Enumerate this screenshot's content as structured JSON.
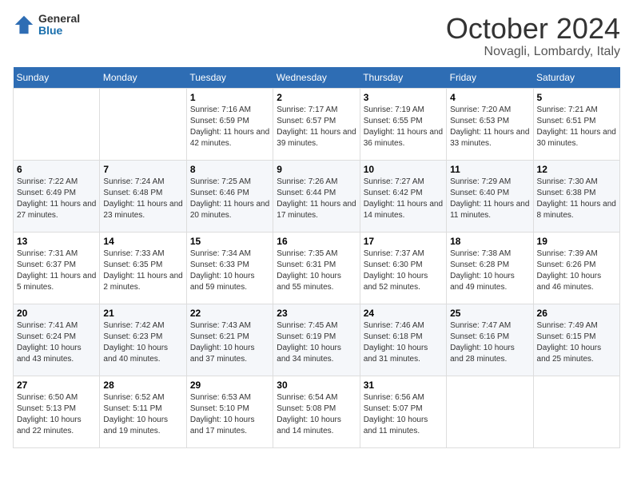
{
  "header": {
    "logo_general": "General",
    "logo_blue": "Blue",
    "month_title": "October 2024",
    "location": "Novagli, Lombardy, Italy"
  },
  "days_of_week": [
    "Sunday",
    "Monday",
    "Tuesday",
    "Wednesday",
    "Thursday",
    "Friday",
    "Saturday"
  ],
  "weeks": [
    [
      {
        "day": "",
        "info": ""
      },
      {
        "day": "",
        "info": ""
      },
      {
        "day": "1",
        "info": "Sunrise: 7:16 AM\nSunset: 6:59 PM\nDaylight: 11 hours and 42 minutes."
      },
      {
        "day": "2",
        "info": "Sunrise: 7:17 AM\nSunset: 6:57 PM\nDaylight: 11 hours and 39 minutes."
      },
      {
        "day": "3",
        "info": "Sunrise: 7:19 AM\nSunset: 6:55 PM\nDaylight: 11 hours and 36 minutes."
      },
      {
        "day": "4",
        "info": "Sunrise: 7:20 AM\nSunset: 6:53 PM\nDaylight: 11 hours and 33 minutes."
      },
      {
        "day": "5",
        "info": "Sunrise: 7:21 AM\nSunset: 6:51 PM\nDaylight: 11 hours and 30 minutes."
      }
    ],
    [
      {
        "day": "6",
        "info": "Sunrise: 7:22 AM\nSunset: 6:49 PM\nDaylight: 11 hours and 27 minutes."
      },
      {
        "day": "7",
        "info": "Sunrise: 7:24 AM\nSunset: 6:48 PM\nDaylight: 11 hours and 23 minutes."
      },
      {
        "day": "8",
        "info": "Sunrise: 7:25 AM\nSunset: 6:46 PM\nDaylight: 11 hours and 20 minutes."
      },
      {
        "day": "9",
        "info": "Sunrise: 7:26 AM\nSunset: 6:44 PM\nDaylight: 11 hours and 17 minutes."
      },
      {
        "day": "10",
        "info": "Sunrise: 7:27 AM\nSunset: 6:42 PM\nDaylight: 11 hours and 14 minutes."
      },
      {
        "day": "11",
        "info": "Sunrise: 7:29 AM\nSunset: 6:40 PM\nDaylight: 11 hours and 11 minutes."
      },
      {
        "day": "12",
        "info": "Sunrise: 7:30 AM\nSunset: 6:38 PM\nDaylight: 11 hours and 8 minutes."
      }
    ],
    [
      {
        "day": "13",
        "info": "Sunrise: 7:31 AM\nSunset: 6:37 PM\nDaylight: 11 hours and 5 minutes."
      },
      {
        "day": "14",
        "info": "Sunrise: 7:33 AM\nSunset: 6:35 PM\nDaylight: 11 hours and 2 minutes."
      },
      {
        "day": "15",
        "info": "Sunrise: 7:34 AM\nSunset: 6:33 PM\nDaylight: 10 hours and 59 minutes."
      },
      {
        "day": "16",
        "info": "Sunrise: 7:35 AM\nSunset: 6:31 PM\nDaylight: 10 hours and 55 minutes."
      },
      {
        "day": "17",
        "info": "Sunrise: 7:37 AM\nSunset: 6:30 PM\nDaylight: 10 hours and 52 minutes."
      },
      {
        "day": "18",
        "info": "Sunrise: 7:38 AM\nSunset: 6:28 PM\nDaylight: 10 hours and 49 minutes."
      },
      {
        "day": "19",
        "info": "Sunrise: 7:39 AM\nSunset: 6:26 PM\nDaylight: 10 hours and 46 minutes."
      }
    ],
    [
      {
        "day": "20",
        "info": "Sunrise: 7:41 AM\nSunset: 6:24 PM\nDaylight: 10 hours and 43 minutes."
      },
      {
        "day": "21",
        "info": "Sunrise: 7:42 AM\nSunset: 6:23 PM\nDaylight: 10 hours and 40 minutes."
      },
      {
        "day": "22",
        "info": "Sunrise: 7:43 AM\nSunset: 6:21 PM\nDaylight: 10 hours and 37 minutes."
      },
      {
        "day": "23",
        "info": "Sunrise: 7:45 AM\nSunset: 6:19 PM\nDaylight: 10 hours and 34 minutes."
      },
      {
        "day": "24",
        "info": "Sunrise: 7:46 AM\nSunset: 6:18 PM\nDaylight: 10 hours and 31 minutes."
      },
      {
        "day": "25",
        "info": "Sunrise: 7:47 AM\nSunset: 6:16 PM\nDaylight: 10 hours and 28 minutes."
      },
      {
        "day": "26",
        "info": "Sunrise: 7:49 AM\nSunset: 6:15 PM\nDaylight: 10 hours and 25 minutes."
      }
    ],
    [
      {
        "day": "27",
        "info": "Sunrise: 6:50 AM\nSunset: 5:13 PM\nDaylight: 10 hours and 22 minutes."
      },
      {
        "day": "28",
        "info": "Sunrise: 6:52 AM\nSunset: 5:11 PM\nDaylight: 10 hours and 19 minutes."
      },
      {
        "day": "29",
        "info": "Sunrise: 6:53 AM\nSunset: 5:10 PM\nDaylight: 10 hours and 17 minutes."
      },
      {
        "day": "30",
        "info": "Sunrise: 6:54 AM\nSunset: 5:08 PM\nDaylight: 10 hours and 14 minutes."
      },
      {
        "day": "31",
        "info": "Sunrise: 6:56 AM\nSunset: 5:07 PM\nDaylight: 10 hours and 11 minutes."
      },
      {
        "day": "",
        "info": ""
      },
      {
        "day": "",
        "info": ""
      }
    ]
  ]
}
